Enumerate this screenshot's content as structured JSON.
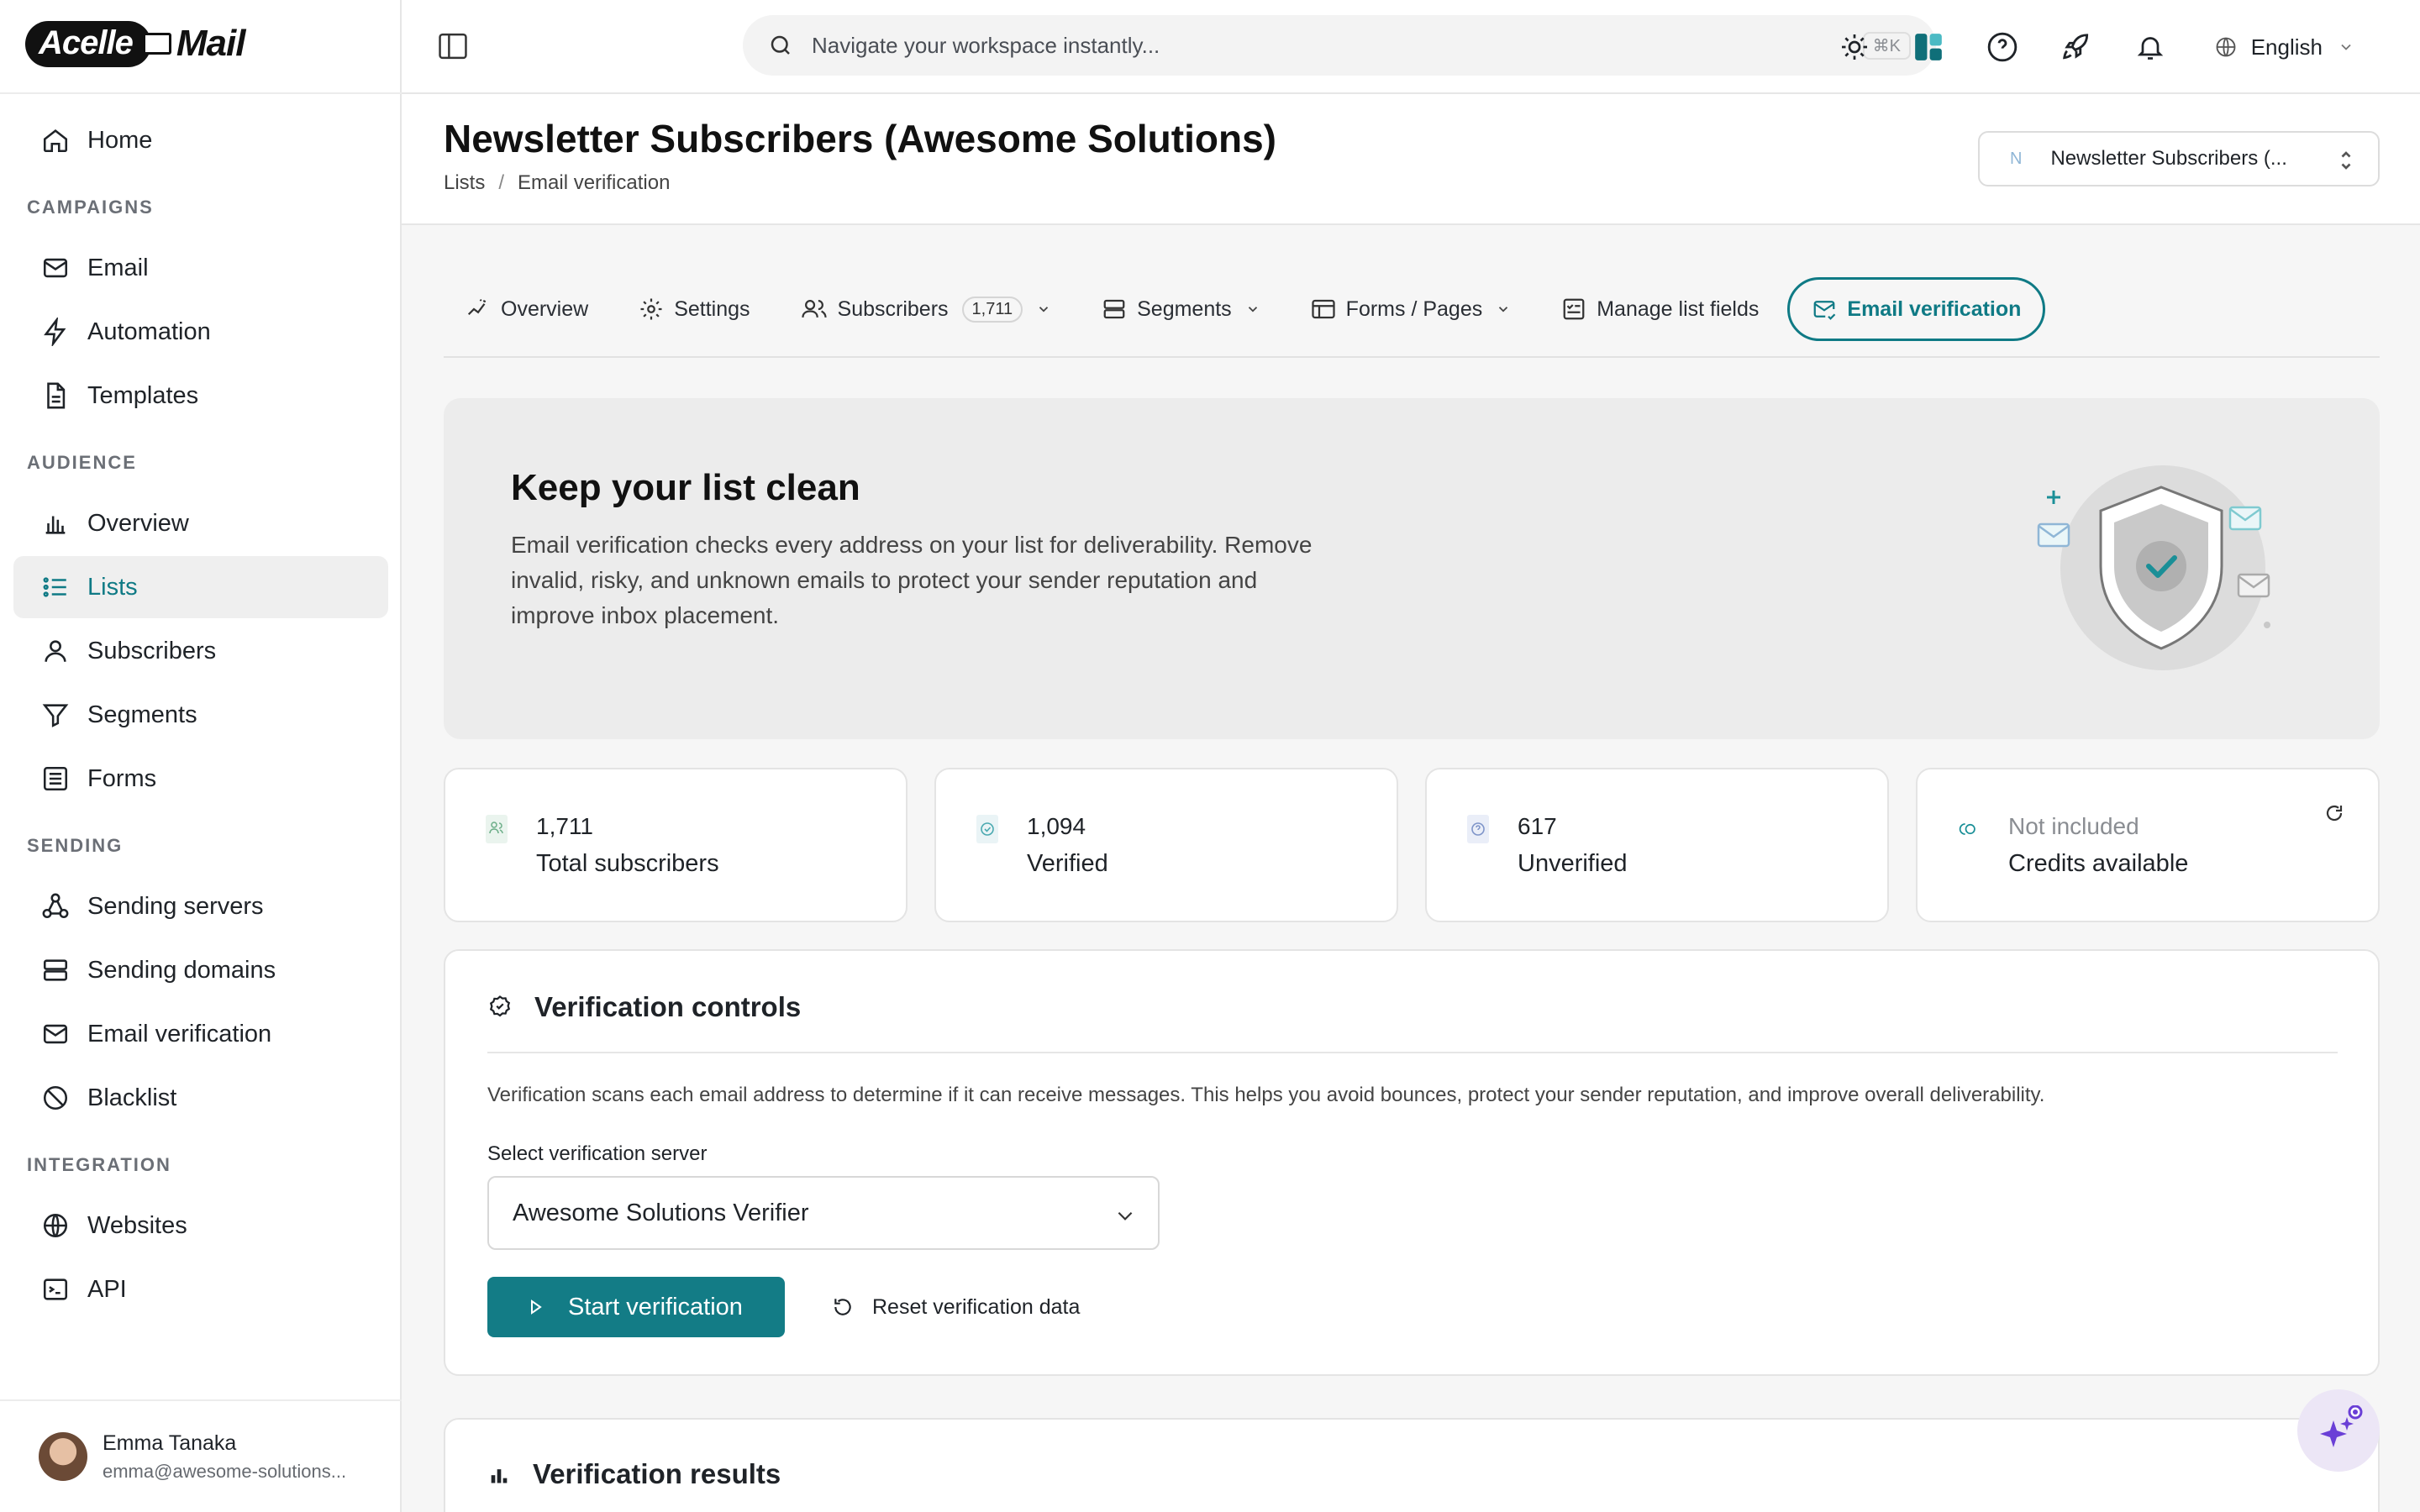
{
  "app": {
    "logo_left": "Acelle",
    "logo_right": "Mail"
  },
  "sidebar": {
    "home": "Home",
    "sections": {
      "campaigns": "CAMPAIGNS",
      "audience": "AUDIENCE",
      "sending": "SENDING",
      "integration": "INTEGRATION"
    },
    "campaigns": [
      "Email",
      "Automation",
      "Templates"
    ],
    "audience": [
      "Overview",
      "Lists",
      "Subscribers",
      "Segments",
      "Forms"
    ],
    "sending": [
      "Sending servers",
      "Sending domains",
      "Email verification",
      "Blacklist"
    ],
    "integration": [
      "Websites",
      "API"
    ],
    "active_item": "Lists",
    "user": {
      "name": "Emma Tanaka",
      "email": "emma@awesome-solutions..."
    }
  },
  "topbar": {
    "search_placeholder": "Navigate your workspace instantly...",
    "search_shortcut": "⌘K",
    "language": "English"
  },
  "header": {
    "title": "Newsletter Subscribers (Awesome Solutions)",
    "breadcrumb": [
      "Lists",
      "Email verification"
    ],
    "list_selector_initial": "N",
    "list_selector_label": "Newsletter Subscribers (..."
  },
  "tabs": {
    "overview": "Overview",
    "settings": "Settings",
    "subscribers": "Subscribers",
    "subscribers_count": "1,711",
    "segments": "Segments",
    "forms": "Forms / Pages",
    "fields": "Manage list fields",
    "verification": "Email verification"
  },
  "hero": {
    "title": "Keep your list clean",
    "description": "Email verification checks every address on your list for deliverability. Remove invalid, risky, and unknown emails to protect your sender reputation and improve inbox placement."
  },
  "stats": [
    {
      "value": "1,711",
      "label": "Total subscribers"
    },
    {
      "value": "1,094",
      "label": "Verified"
    },
    {
      "value": "617",
      "label": "Unverified"
    },
    {
      "value": "Not included",
      "label": "Credits available"
    }
  ],
  "controls": {
    "title": "Verification controls",
    "description": "Verification scans each email address to determine if it can receive messages. This helps you avoid bounces, protect your sender reputation, and improve overall deliverability.",
    "server_label": "Select verification server",
    "server_value": "Awesome Solutions Verifier",
    "start_button": "Start verification",
    "reset_button": "Reset verification data"
  },
  "results": {
    "title": "Verification results"
  },
  "colors": {
    "accent": "#137c86",
    "active_text": "#0f7a85"
  }
}
